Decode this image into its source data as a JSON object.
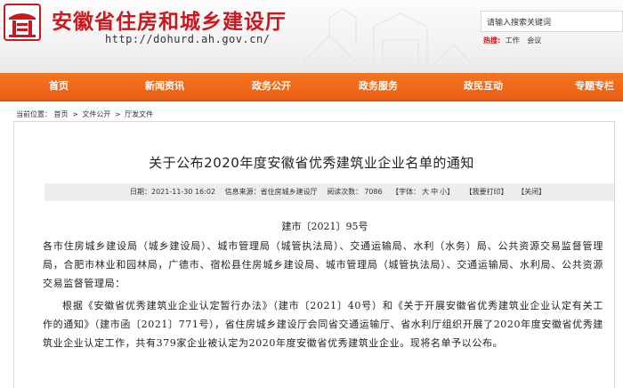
{
  "header": {
    "site_name": "安徽省住房和城乡建设厅",
    "site_url": "http://dohurd.ah.gov.cn/",
    "search_placeholder": "请输入搜索关键词",
    "hotwords_label": "热搜:",
    "hotwords": [
      "工作",
      "会议"
    ]
  },
  "nav": {
    "items": [
      "首页",
      "新闻资讯",
      "政务公开",
      "政务服务",
      "政民互动",
      "专题专栏"
    ]
  },
  "breadcrumb": {
    "label": "当前位置：",
    "items": [
      "首页",
      "文件公开",
      "厅发文件"
    ],
    "separator": ">"
  },
  "article": {
    "title": "关于公布2020年度安徽省优秀建筑业企业名单的通知",
    "meta": {
      "date": "日期：2021-11-30 16:02",
      "source": "信息来源：省住房城乡建设厅",
      "views_label": "阅读次数：",
      "views": "7086",
      "font_label": "【字体：",
      "font_large": "大",
      "font_medium": "中",
      "font_small": "小】",
      "print": "【我要打印】",
      "close": "【关闭】"
    },
    "doc_number": "建市〔2021〕95号",
    "paragraph1": "各市住房城乡建设局（城乡建设局）、城市管理局（城管执法局）、交通运输局、水利（水务）局、公共资源交易监督管理局，合肥市林业和园林局，广德市、宿松县住房城乡建设局、城市管理局（城管执法局）、交通运输局、水利局、公共资源交易监督管理局：",
    "paragraph2": "根据《安徽省优秀建筑业企业认定暂行办法》（建市〔2021〕40号）和《关于开展安徽省优秀建筑业企业认定有关工作的通知》（建市函〔2021〕771号），省住房城乡建设厅会同省交通运输厅、省水利厅组织开展了2020年度安徽省优秀建筑业企业认定工作，共有379家企业被认定为2020年度安徽省优秀建筑业企业。现将名单予以公布。"
  },
  "colors": {
    "brand_red": "#c9181e",
    "nav_orange": "#f06a1a"
  }
}
